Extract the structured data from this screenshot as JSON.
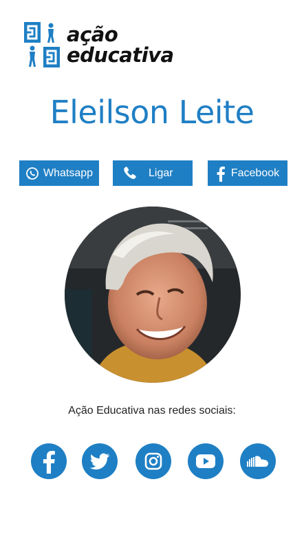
{
  "brand": {
    "line1": "ação",
    "line2": "educativa"
  },
  "profile": {
    "name": "Eleilson Leite"
  },
  "buttons": {
    "whatsapp": "Whatsapp",
    "call": "Ligar",
    "facebook": "Facebook"
  },
  "social_section": {
    "title": "Ação Educativa nas redes sociais:",
    "icons": [
      "facebook-icon",
      "twitter-icon",
      "instagram-icon",
      "youtube-icon",
      "soundcloud-icon"
    ]
  },
  "colors": {
    "accent": "#1f7fc4"
  }
}
